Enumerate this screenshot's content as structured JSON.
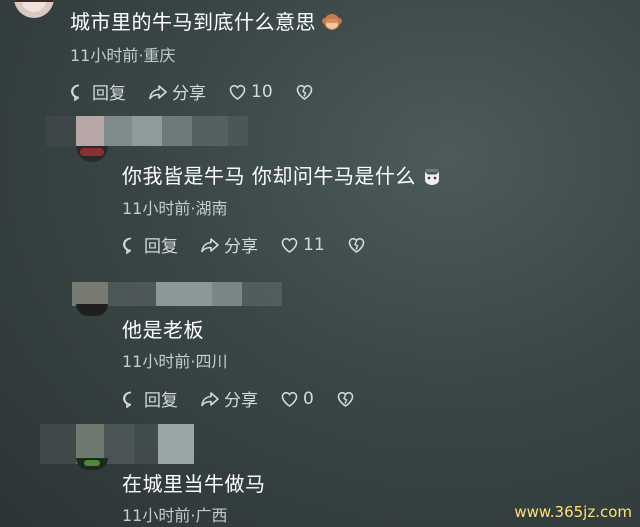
{
  "comments": [
    {
      "text": "城市里的牛马到底什么意思",
      "meta": "11小时前·重庆",
      "reply_label": "回复",
      "share_label": "分享",
      "like_count": "10"
    },
    {
      "text": "你我皆是牛马 你却问牛马是什么",
      "meta": "11小时前·湖南",
      "reply_label": "回复",
      "share_label": "分享",
      "like_count": "11"
    },
    {
      "text": "他是老板",
      "meta": "11小时前·四川",
      "reply_label": "回复",
      "share_label": "分享",
      "like_count": "0"
    },
    {
      "text": "在城里当牛做马",
      "meta": "11小时前·广西"
    }
  ],
  "watermark": "www.365jz.com"
}
